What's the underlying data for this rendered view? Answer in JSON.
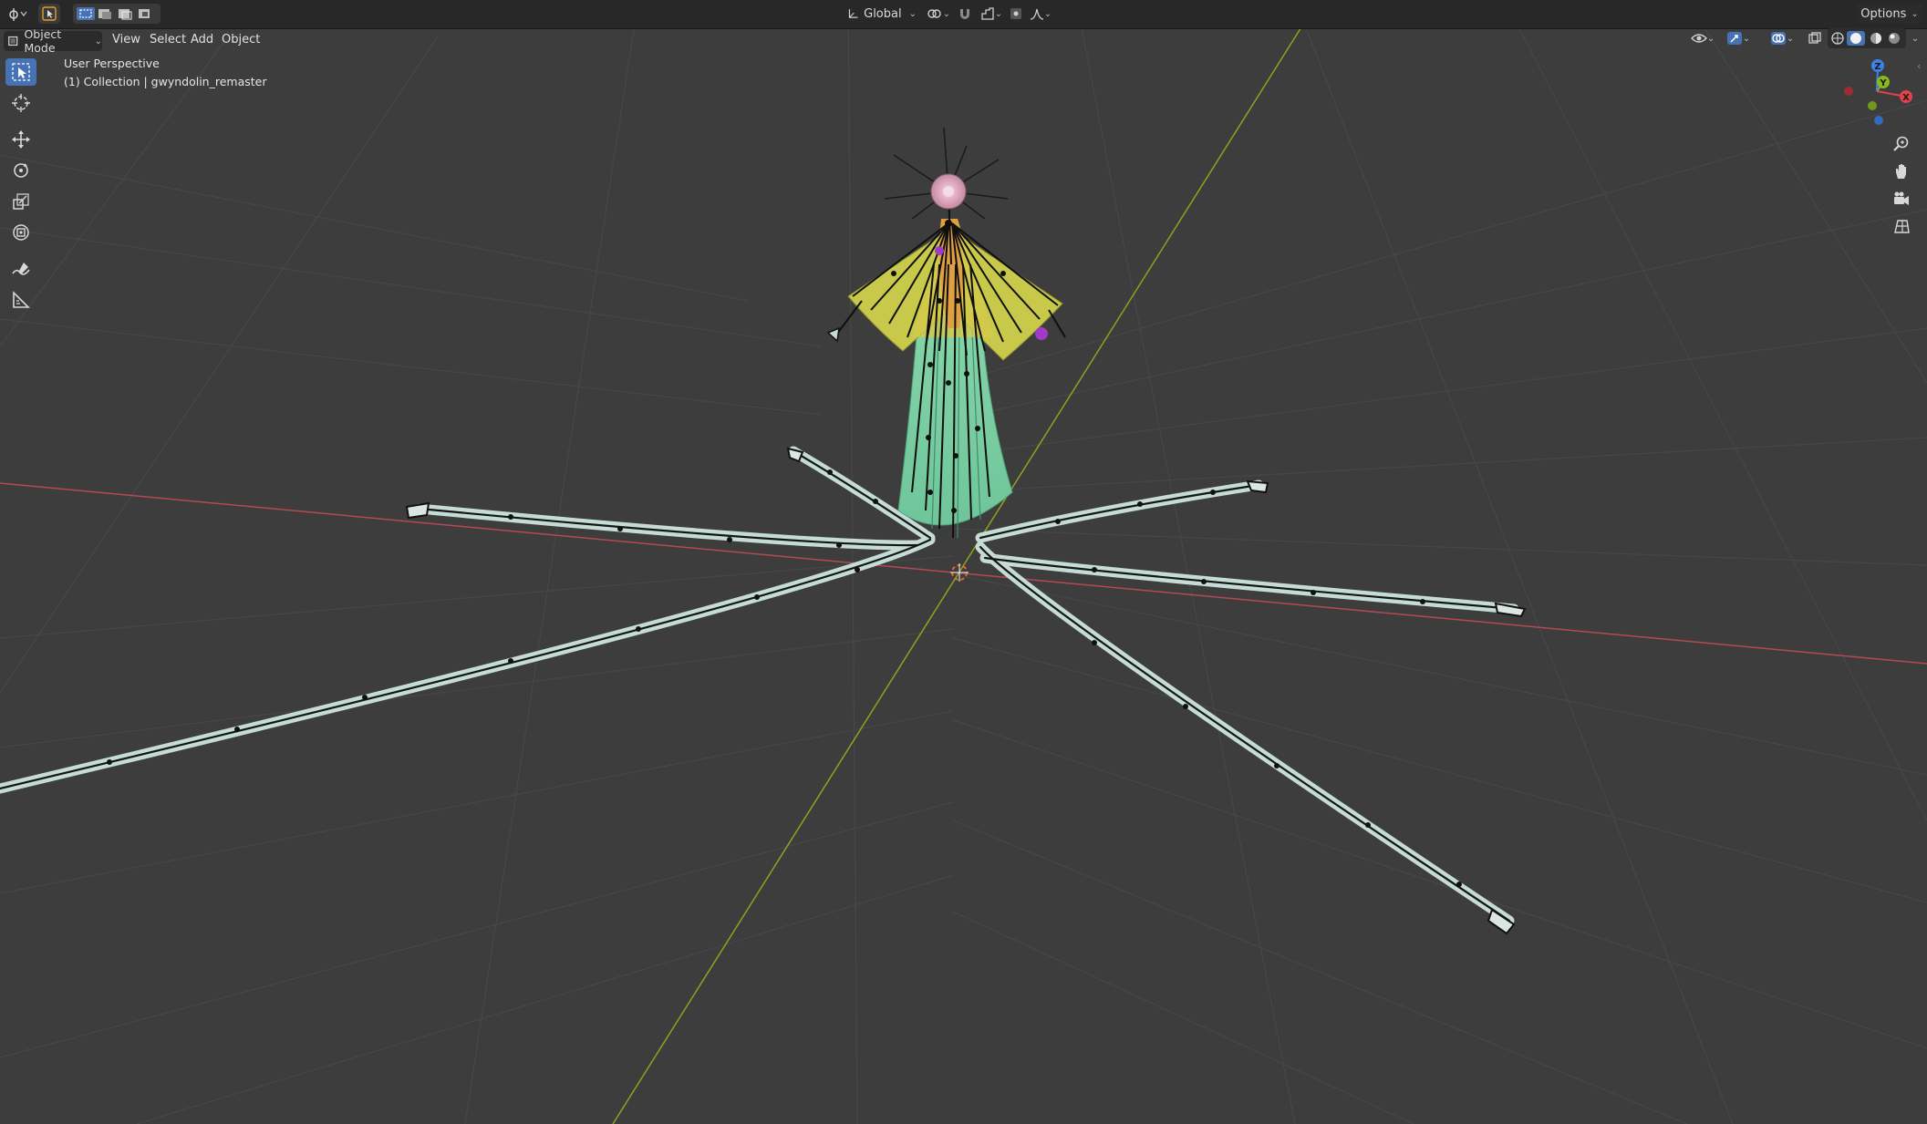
{
  "header": {
    "transform_orientation": "Global",
    "options_label": "Options"
  },
  "menubar": {
    "mode": "Object Mode",
    "items": [
      "View",
      "Select",
      "Add",
      "Object"
    ]
  },
  "viewport": {
    "view_name": "User Perspective",
    "collection_info": "(1) Collection | gwyndolin_remaster"
  },
  "gizmo": {
    "x": "X",
    "y": "Y",
    "z": "Z"
  },
  "icons": {
    "editor_type": "editor-type-icon",
    "select_box": "select-box-icon",
    "cursor": "cursor-icon",
    "move": "move-icon",
    "rotate": "rotate-icon",
    "scale": "scale-icon",
    "transform": "transform-icon",
    "annotate": "annotate-icon",
    "measure": "measure-icon",
    "zoom": "zoom-icon",
    "pan": "hand-icon",
    "camera": "camera-icon",
    "ortho": "grid-icon"
  },
  "colors": {
    "header_bg": "#282828",
    "viewport_bg": "#3d3d3d",
    "active_tool": "#4772b3",
    "x_axis": "#b34a55",
    "y_axis": "#8fa31f",
    "gizmo_x": "#e0424c",
    "gizmo_y": "#86b81f",
    "gizmo_z": "#3b82e6"
  }
}
